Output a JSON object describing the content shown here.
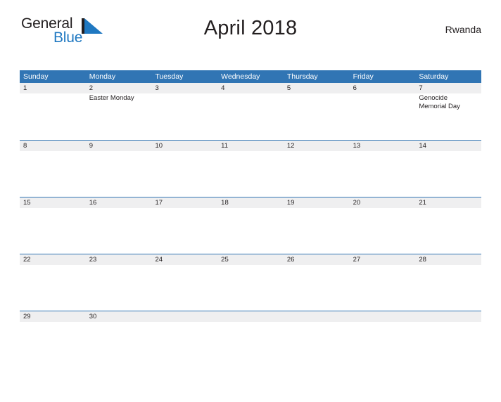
{
  "brand": {
    "word_one": "General",
    "word_two": "Blue",
    "logo_icon": "flag-triangle-icon",
    "dark_color": "#231f20",
    "blue_color": "#1f78c1"
  },
  "header": {
    "title": "April 2018",
    "country": "Rwanda"
  },
  "theme": {
    "header_blue": "#3175b4",
    "row_gray": "#efeff0",
    "text_color": "#231f20"
  },
  "calendar": {
    "weekdays": [
      "Sunday",
      "Monday",
      "Tuesday",
      "Wednesday",
      "Thursday",
      "Friday",
      "Saturday"
    ],
    "weeks": [
      [
        {
          "day": "1",
          "events": []
        },
        {
          "day": "2",
          "events": [
            "Easter Monday"
          ]
        },
        {
          "day": "3",
          "events": []
        },
        {
          "day": "4",
          "events": []
        },
        {
          "day": "5",
          "events": []
        },
        {
          "day": "6",
          "events": []
        },
        {
          "day": "7",
          "events": [
            "Genocide\nMemorial Day"
          ]
        }
      ],
      [
        {
          "day": "8",
          "events": []
        },
        {
          "day": "9",
          "events": []
        },
        {
          "day": "10",
          "events": []
        },
        {
          "day": "11",
          "events": []
        },
        {
          "day": "12",
          "events": []
        },
        {
          "day": "13",
          "events": []
        },
        {
          "day": "14",
          "events": []
        }
      ],
      [
        {
          "day": "15",
          "events": []
        },
        {
          "day": "16",
          "events": []
        },
        {
          "day": "17",
          "events": []
        },
        {
          "day": "18",
          "events": []
        },
        {
          "day": "19",
          "events": []
        },
        {
          "day": "20",
          "events": []
        },
        {
          "day": "21",
          "events": []
        }
      ],
      [
        {
          "day": "22",
          "events": []
        },
        {
          "day": "23",
          "events": []
        },
        {
          "day": "24",
          "events": []
        },
        {
          "day": "25",
          "events": []
        },
        {
          "day": "26",
          "events": []
        },
        {
          "day": "27",
          "events": []
        },
        {
          "day": "28",
          "events": []
        }
      ],
      [
        {
          "day": "29",
          "events": []
        },
        {
          "day": "30",
          "events": []
        },
        {
          "day": "",
          "events": []
        },
        {
          "day": "",
          "events": []
        },
        {
          "day": "",
          "events": []
        },
        {
          "day": "",
          "events": []
        },
        {
          "day": "",
          "events": []
        }
      ]
    ]
  }
}
